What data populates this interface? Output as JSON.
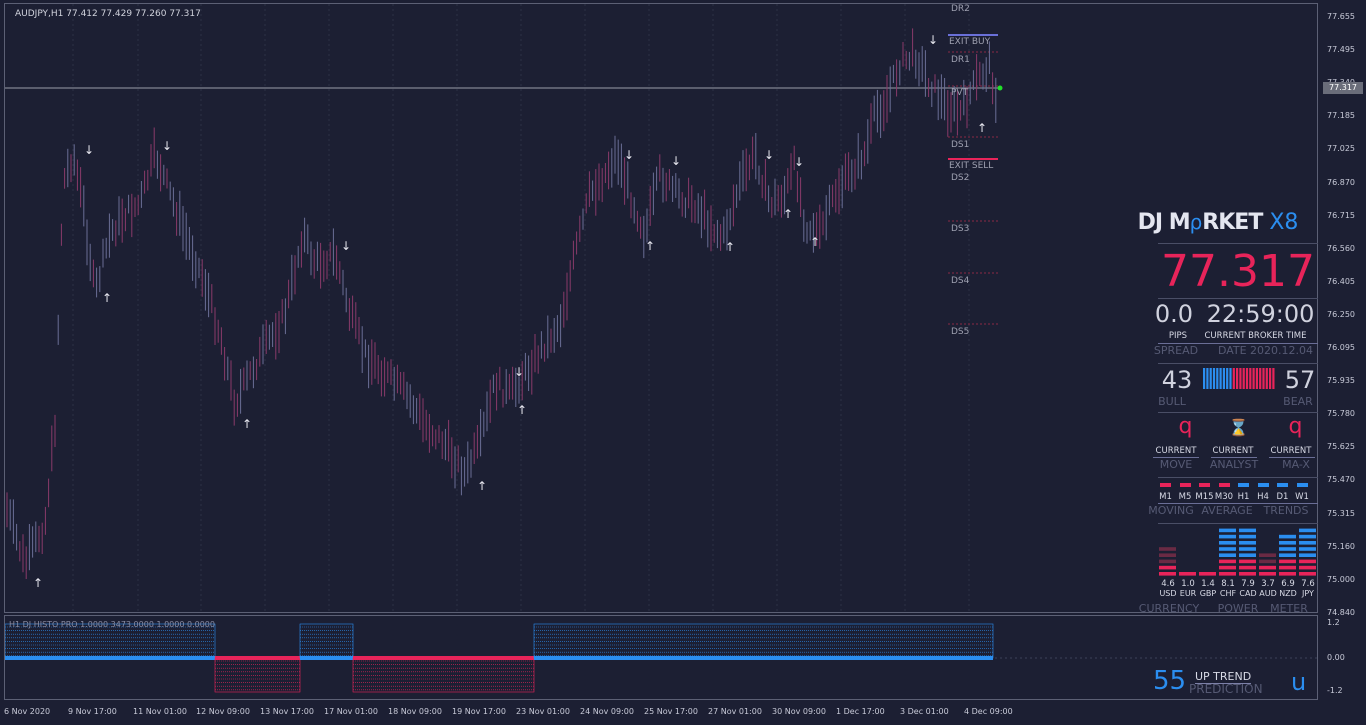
{
  "symbol_header": "AUDJPY,H1  77.412 77.429 77.260 77.317",
  "indicator_header": "H1 DJ HISTO PRO 1.0000 3473.0000 1.0000 0.0000",
  "current_price_box": "77.317",
  "price_axis": [
    "77.655",
    "77.495",
    "77.340",
    "77.185",
    "77.025",
    "76.870",
    "76.715",
    "76.560",
    "76.405",
    "76.250",
    "76.095",
    "75.935",
    "75.780",
    "75.625",
    "75.470",
    "75.315",
    "75.160",
    "75.000",
    "74.840"
  ],
  "sub_axis": [
    "1.2",
    "0.00",
    "-1.2"
  ],
  "time_axis": [
    "6 Nov 2020",
    "9 Nov 17:00",
    "11 Nov 01:00",
    "12 Nov 09:00",
    "13 Nov 17:00",
    "17 Nov 01:00",
    "18 Nov 09:00",
    "19 Nov 17:00",
    "23 Nov 01:00",
    "24 Nov 09:00",
    "25 Nov 17:00",
    "27 Nov 01:00",
    "30 Nov 09:00",
    "1 Dec 17:00",
    "3 Dec 01:00",
    "4 Dec 09:00"
  ],
  "levels": {
    "dr2": "DR2",
    "exit_buy": "EXIT BUY",
    "dr1": "DR1",
    "pvt": "PVT",
    "ds1": "DS1",
    "exit_sell": "EXIT SELL",
    "ds2": "DS2",
    "ds3": "DS3",
    "ds4": "DS4",
    "ds5": "DS5"
  },
  "panel": {
    "title_a": "DJ M",
    "title_b": "RKET",
    "title_c": "X8",
    "title_glyph": "ρ",
    "price": "77.317",
    "spread_value": "0.0",
    "time_value": "22:59:00",
    "pips_label": "PIPS",
    "cbt_label": "CURRENT BROKER TIME",
    "spread_label": "SPREAD",
    "date_label": "DATE 2020.12.04",
    "bull_value": "43",
    "bear_value": "57",
    "bull_label": "BULL",
    "bear_label": "BEAR",
    "move_icon": "q",
    "analyst_icon": "⌛",
    "max_icon": "q",
    "current1": "CURRENT",
    "current2": "CURRENT",
    "current3": "CURRENT",
    "move_label": "MOVE",
    "analyst_label": "ANALYST",
    "max_label": "MA-X",
    "tf_labels": [
      "M1",
      "M5",
      "M15",
      "M30",
      "H1",
      "H4",
      "D1",
      "W1"
    ],
    "tf_colors": [
      "#e8245a",
      "#e8245a",
      "#e8245a",
      "#e8245a",
      "#2b8ef0",
      "#2b8ef0",
      "#2b8ef0",
      "#2b8ef0"
    ],
    "moving_label": "MOVING",
    "average_label": "AVERAGE",
    "trends_label": "TRENDS",
    "currency_values": [
      "4.6",
      "1.0",
      "1.4",
      "8.1",
      "7.9",
      "3.7",
      "6.9",
      "7.6"
    ],
    "currency_names": [
      "USD",
      "EUR",
      "GBP",
      "CHF",
      "CAD",
      "AUD",
      "NZD",
      "JPY"
    ],
    "currency_label": "CURRENCY",
    "power_label": "POWER",
    "meter_label": "METER"
  },
  "prediction": {
    "value": "55",
    "line1": "UP TREND",
    "line2": "PREDICTION",
    "icon": "u"
  },
  "colors": {
    "bull": "#2b8ef0",
    "bear": "#e8245a",
    "bg": "#1c1f33"
  }
}
